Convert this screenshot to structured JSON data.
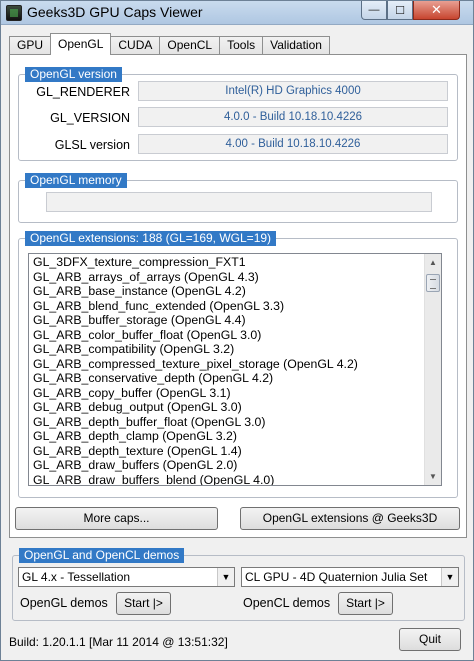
{
  "window": {
    "title": "Geeks3D GPU Caps Viewer",
    "close_glyph": "✕",
    "min_glyph": "—",
    "max_glyph": "☐"
  },
  "tabs": [
    {
      "label": "GPU"
    },
    {
      "label": "OpenGL",
      "active": true
    },
    {
      "label": "CUDA"
    },
    {
      "label": "OpenCL"
    },
    {
      "label": "Tools"
    },
    {
      "label": "Validation"
    }
  ],
  "opengl_version": {
    "title": "OpenGL version",
    "rows": [
      {
        "label": "GL_RENDERER",
        "value": "Intel(R) HD Graphics 4000"
      },
      {
        "label": "GL_VERSION",
        "value": "4.0.0 - Build 10.18.10.4226"
      },
      {
        "label": "GLSL version",
        "value": "4.00 - Build 10.18.10.4226"
      }
    ]
  },
  "opengl_memory": {
    "title": "OpenGL memory",
    "value": ""
  },
  "extensions": {
    "title": "OpenGL extensions: 188 (GL=169, WGL=19)",
    "items": [
      "GL_3DFX_texture_compression_FXT1",
      "GL_ARB_arrays_of_arrays (OpenGL 4.3)",
      "GL_ARB_base_instance (OpenGL 4.2)",
      "GL_ARB_blend_func_extended (OpenGL 3.3)",
      "GL_ARB_buffer_storage (OpenGL 4.4)",
      "GL_ARB_color_buffer_float (OpenGL 3.0)",
      "GL_ARB_compatibility (OpenGL 3.2)",
      "GL_ARB_compressed_texture_pixel_storage (OpenGL 4.2)",
      "GL_ARB_conservative_depth (OpenGL 4.2)",
      "GL_ARB_copy_buffer (OpenGL 3.1)",
      "GL_ARB_debug_output (OpenGL 3.0)",
      "GL_ARB_depth_buffer_float (OpenGL 3.0)",
      "GL_ARB_depth_clamp (OpenGL 3.2)",
      "GL_ARB_depth_texture (OpenGL 1.4)",
      "GL_ARB_draw_buffers (OpenGL 2.0)",
      "GL_ARB_draw_buffers_blend (OpenGL 4.0)"
    ]
  },
  "buttons": {
    "more_caps": "More caps...",
    "ext_geeks3d": "OpenGL extensions @ Geeks3D",
    "quit": "Quit"
  },
  "demos": {
    "title": "OpenGL and OpenCL demos",
    "gl_selected": "GL 4.x - Tessellation",
    "cl_selected": "CL GPU - 4D Quaternion Julia Set",
    "gl_label": "OpenGL demos",
    "cl_label": "OpenCL demos",
    "start_label": "Start |>"
  },
  "status": {
    "build": "Build: 1.20.1.1 [Mar 11 2014 @ 13:51:32]"
  },
  "icons": {
    "scroll_up": "▲",
    "scroll_down": "▼",
    "dropdown": "▼"
  }
}
